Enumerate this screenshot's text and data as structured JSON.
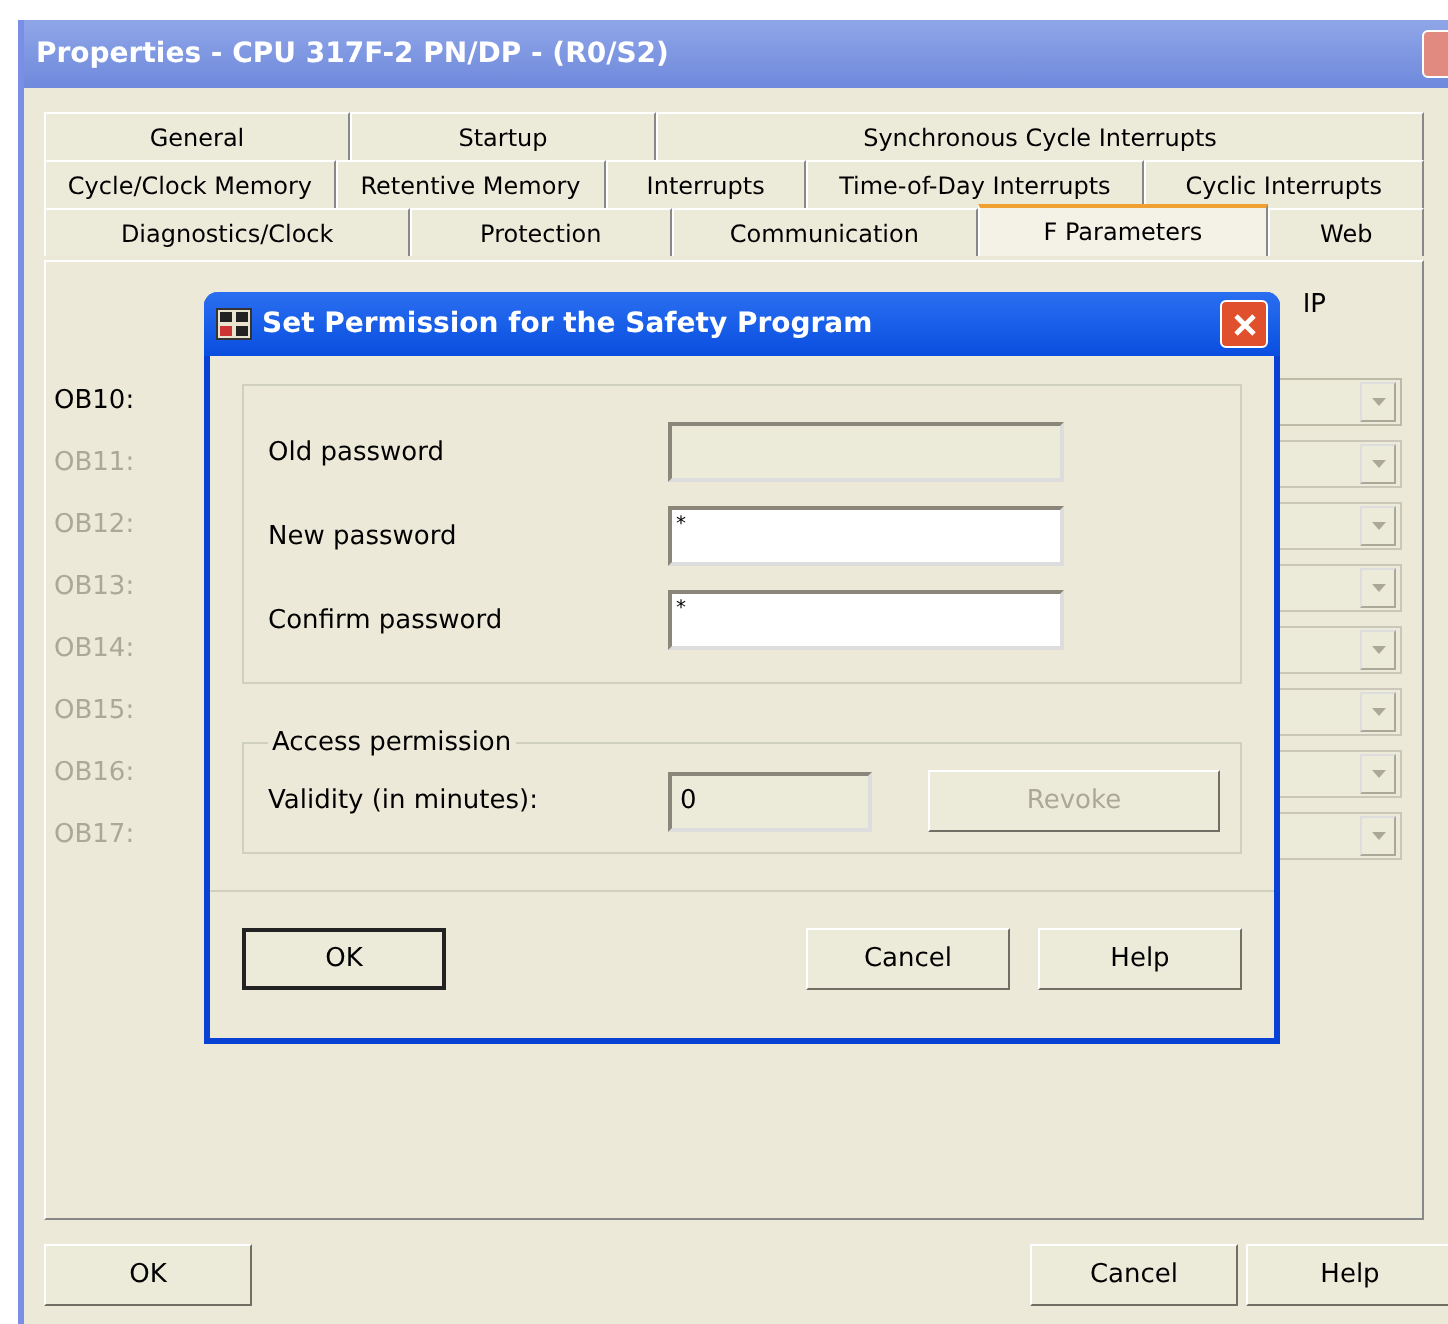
{
  "window": {
    "title": "Properties - CPU 317F-2 PN/DP - (R0/S2)"
  },
  "tab_rows": [
    {
      "tabs": [
        {
          "label": "General",
          "selected": false
        },
        {
          "label": "Startup",
          "selected": false
        },
        {
          "label": "Synchronous Cycle Interrupts",
          "selected": false
        }
      ]
    },
    {
      "tabs": [
        {
          "label": "Cycle/Clock Memory",
          "selected": false
        },
        {
          "label": "Retentive Memory",
          "selected": false
        },
        {
          "label": "Interrupts",
          "selected": false
        },
        {
          "label": "Time-of-Day Interrupts",
          "selected": false
        },
        {
          "label": "Cyclic Interrupts",
          "selected": false
        }
      ]
    },
    {
      "tabs": [
        {
          "label": "Diagnostics/Clock",
          "selected": false
        },
        {
          "label": "Protection",
          "selected": false
        },
        {
          "label": "Communication",
          "selected": false
        },
        {
          "label": "F Parameters",
          "selected": true
        },
        {
          "label": "Web",
          "selected": false
        }
      ]
    }
  ],
  "panel": {
    "column_heading": "IP",
    "rows": [
      {
        "label": "OB10:",
        "disabled": false
      },
      {
        "label": "OB11:",
        "disabled": true
      },
      {
        "label": "OB12:",
        "disabled": true
      },
      {
        "label": "OB13:",
        "disabled": true
      },
      {
        "label": "OB14:",
        "disabled": true
      },
      {
        "label": "OB15:",
        "disabled": true
      },
      {
        "label": "OB16:",
        "disabled": true
      },
      {
        "label": "OB17:",
        "disabled": true
      }
    ]
  },
  "dialog": {
    "title": "Set Permission for the Safety Program",
    "fields": [
      {
        "label": "Old password",
        "disabled": true
      },
      {
        "label": "New password",
        "value": "*",
        "disabled": false
      },
      {
        "label": "Confirm password",
        "value": "*",
        "disabled": false
      }
    ],
    "access_group": {
      "title": "Access permission",
      "validity_label": "Validity (in minutes):",
      "validity_value": "0",
      "revoke_button": {
        "label": "Revoke",
        "disabled": true
      }
    },
    "buttons": [
      {
        "label": "OK",
        "default": true
      },
      {
        "label": "Cancel",
        "default": false
      },
      {
        "label": "Help",
        "default": false
      }
    ]
  },
  "buttons": [
    "OK",
    "Cancel",
    "Help"
  ]
}
